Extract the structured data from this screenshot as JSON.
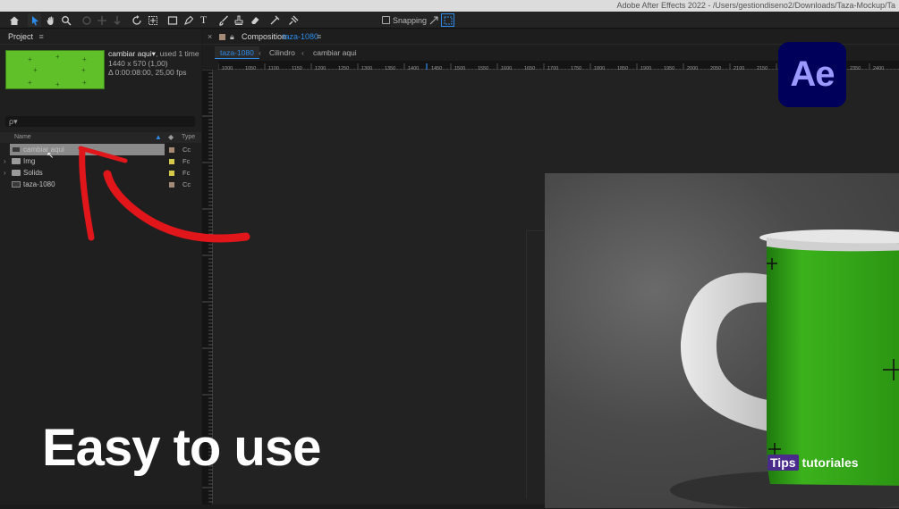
{
  "window": {
    "title": "Adobe After Effects 2022 - /Users/gestiondiseno2/Downloads/Taza-Mockup/Ta"
  },
  "toolbar": {
    "tools": [
      "home-icon",
      "selection-tool-icon",
      "hand-tool-icon",
      "zoom-tool-icon",
      "orbit-camera-icon",
      "track-xy-camera-icon",
      "dolly-camera-icon",
      "rotation-tool-icon",
      "anchor-point-tool-icon",
      "rectangle-tool-icon",
      "pen-tool-icon",
      "type-tool-icon",
      "brush-tool-icon",
      "clone-stamp-tool-icon",
      "eraser-tool-icon",
      "roto-brush-tool-icon",
      "puppet-pin-tool-icon"
    ],
    "snapping_label": "Snapping"
  },
  "project": {
    "panel_title": "Project",
    "selected_name": "cambiar aqui",
    "used_text": ", used 1 time",
    "dimensions": "1440 x 570 (1,00)",
    "duration": "Δ 0:00:08:00, 25,00 fps",
    "search_placeholder": "ρ▾",
    "col_name": "Name",
    "col_type": "Type",
    "items": [
      {
        "name": "cambiar aqui",
        "type": "Cc",
        "chip_color": "#a58a77",
        "icon": "composition-icon",
        "selected": true
      },
      {
        "name": "Img",
        "type": "Fc",
        "chip_color": "#d6c84a",
        "icon": "folder-icon",
        "selected": false
      },
      {
        "name": "Solids",
        "type": "Fc",
        "chip_color": "#d6c84a",
        "icon": "folder-icon",
        "selected": false
      },
      {
        "name": "taza-1080",
        "type": "Cc",
        "chip_color": "#a58a77",
        "icon": "composition-icon",
        "selected": false
      }
    ]
  },
  "composition": {
    "panel_label": "Composition",
    "comp_name": "taza-1080",
    "breadcrumbs": [
      "taza-1080",
      "Cilindro",
      "cambiar aqui"
    ],
    "ruler_labels": [
      "1000",
      "1050",
      "1100",
      "1150",
      "1200",
      "1250",
      "1300",
      "1350",
      "1400",
      "1450",
      "1500",
      "1550",
      "1600",
      "1650",
      "1700",
      "1750",
      "1800",
      "1850",
      "1900",
      "1950",
      "2000",
      "2050",
      "2100",
      "2150",
      "2200",
      "2250",
      "2300",
      "2350",
      "2400"
    ]
  },
  "overlay": {
    "logo_text": "Ae",
    "headline": "Easy to use",
    "brand_tips": "Tips",
    "brand_tutoriales": "tutoriales"
  },
  "colors": {
    "accent_blue": "#2d8ceb",
    "arrow_red": "#e0161b",
    "mug_green": "#2e9a14",
    "logo_bg": "#00005b",
    "logo_fg": "#9999ff"
  }
}
